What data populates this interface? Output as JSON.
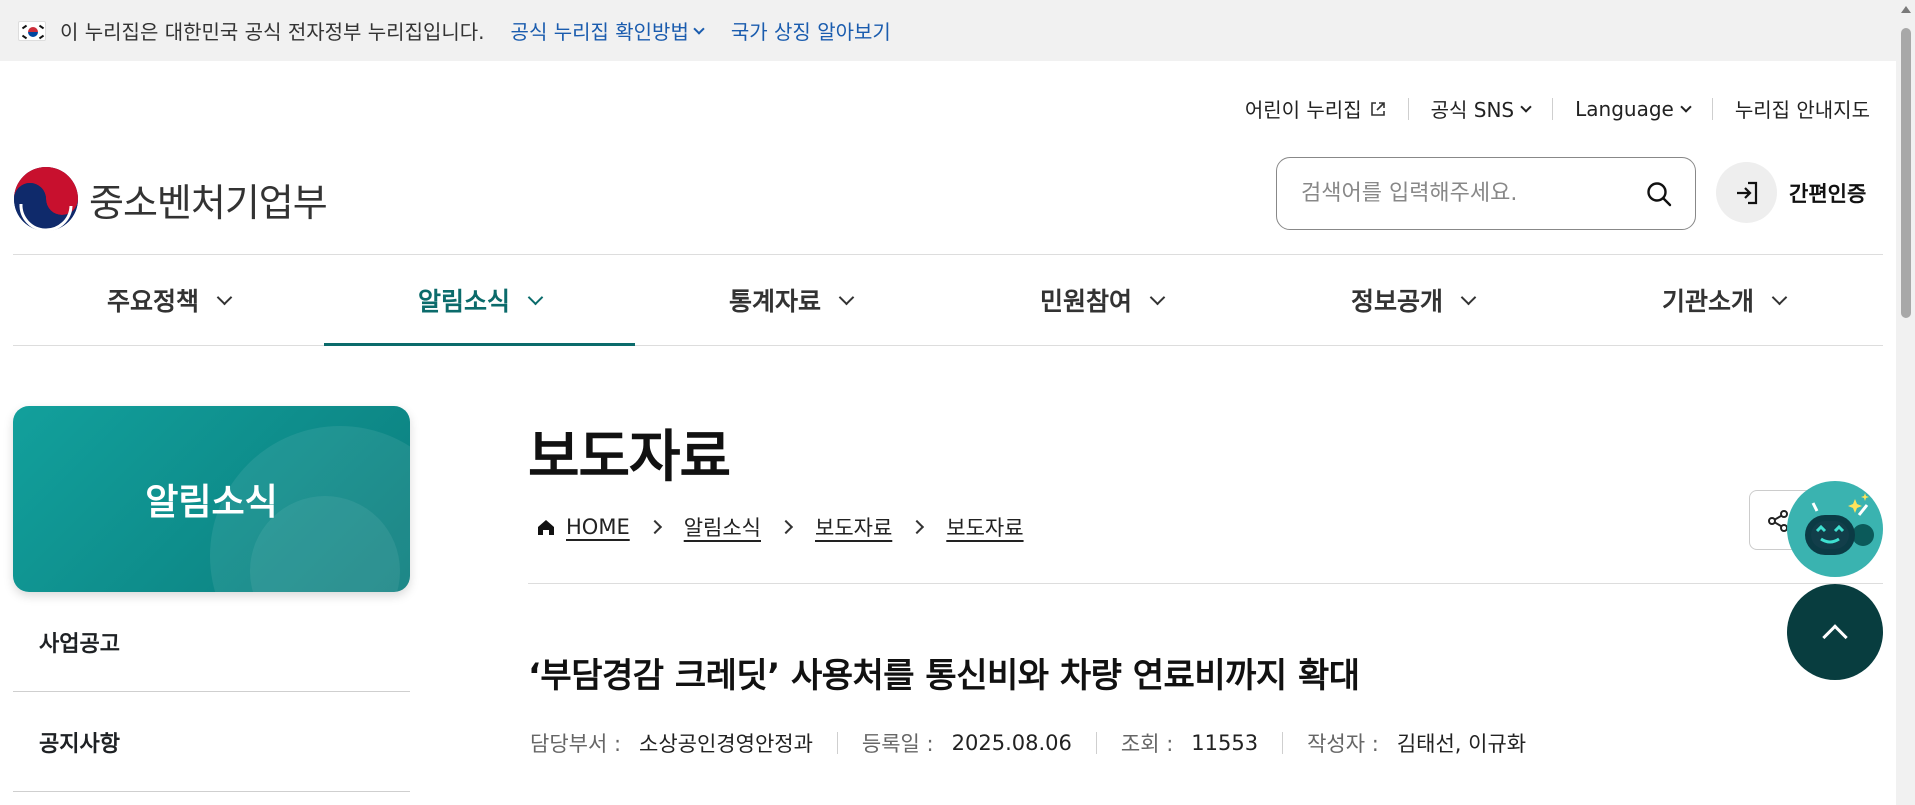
{
  "gov_banner": {
    "text": "이 누리집은 대한민국 공식 전자정부 누리집입니다.",
    "verify_link": "공식 누리집 확인방법",
    "symbol_link": "국가 상징 알아보기"
  },
  "util_nav": {
    "kids": "어린이 누리집",
    "sns": "공식 SNS",
    "language": "Language",
    "sitemap": "누리집 안내지도"
  },
  "header": {
    "logo_text": "중소벤처기업부",
    "search_placeholder": "검색어를 입력해주세요.",
    "login_label": "간편인증"
  },
  "main_nav": {
    "tabs": [
      {
        "label": "주요정책"
      },
      {
        "label": "알림소식"
      },
      {
        "label": "통계자료"
      },
      {
        "label": "민원참여"
      },
      {
        "label": "정보공개"
      },
      {
        "label": "기관소개"
      }
    ],
    "active_index": 1
  },
  "sidebar": {
    "title": "알림소식",
    "items": [
      {
        "label": "사업공고"
      },
      {
        "label": "공지사항"
      }
    ]
  },
  "content": {
    "page_title": "보도자료",
    "breadcrumb": [
      "HOME",
      "알림소식",
      "보도자료",
      "보도자료"
    ],
    "article_title": "‘부담경감 크레딧’ 사용처를 통신비와 차량 연료비까지 확대",
    "meta": {
      "dept_key": "담당부서 :",
      "dept_val": "소상공인경영안정과",
      "date_key": "등록일 :",
      "date_val": "2025.08.06",
      "views_key": "조회 :",
      "views_val": "11553",
      "author_key": "작성자 :",
      "author_val": "김태선, 이규화"
    }
  },
  "colors": {
    "accent": "#0b6b6b",
    "hero_start": "#12a09c",
    "hero_end": "#0b7d7d",
    "top_button": "#083d3f",
    "chatbot": "#3ab3b0",
    "gov_link": "#1a5cae"
  },
  "icons": {
    "flag": "korea-flag-icon",
    "external": "external-link-icon",
    "search": "search-icon",
    "login": "login-arrow-icon",
    "home": "home-icon",
    "share": "share-icon",
    "chatbot": "chatbot-robot-icon",
    "top": "chevron-up-icon"
  }
}
